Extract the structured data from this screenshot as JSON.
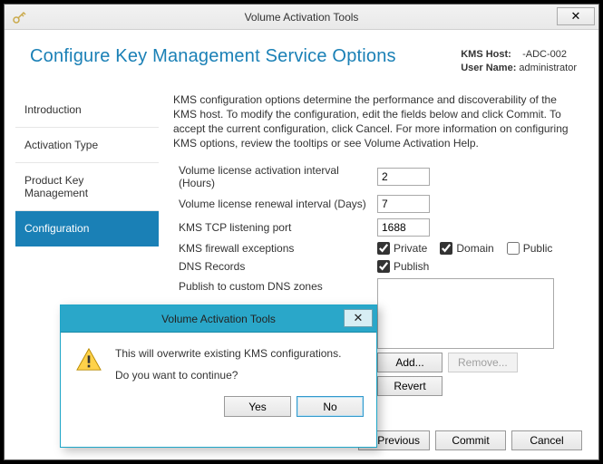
{
  "window": {
    "title": "Volume Activation Tools",
    "close_glyph": "✕"
  },
  "header": {
    "title": "Configure Key Management Service Options",
    "kms_host_label": "KMS Host:",
    "kms_host_value": "-ADC-002",
    "user_label": "User Name:",
    "user_value": "administrator"
  },
  "sidebar": {
    "items": [
      {
        "label": "Introduction"
      },
      {
        "label": "Activation Type"
      },
      {
        "label": "Product Key Management"
      },
      {
        "label": "Configuration"
      }
    ],
    "active_index": 3
  },
  "content": {
    "description": "KMS configuration options determine the performance and discoverability of the KMS host. To modify the configuration, edit the fields below and click Commit. To accept the current configuration, click Cancel. For more information on configuring KMS options, review the tooltips or see Volume Activation Help.",
    "fields": {
      "activation_interval_label": "Volume license activation interval (Hours)",
      "activation_interval_value": "2",
      "renewal_interval_label": "Volume license renewal interval (Days)",
      "renewal_interval_value": "7",
      "tcp_port_label": "KMS TCP listening port",
      "tcp_port_value": "1688",
      "firewall_label": "KMS firewall exceptions",
      "firewall_private": "Private",
      "firewall_domain": "Domain",
      "firewall_public": "Public",
      "dns_label": "DNS Records",
      "dns_publish": "Publish",
      "custom_dns_label": "Publish to custom DNS zones",
      "add_btn": "Add...",
      "remove_btn": "Remove...",
      "revert_btn": "Revert"
    }
  },
  "footer": {
    "previous": "<  Previous",
    "commit": "Commit",
    "cancel": "Cancel"
  },
  "dialog": {
    "title": "Volume Activation Tools",
    "close_glyph": "✕",
    "line1": "This will overwrite existing KMS configurations.",
    "line2": "Do you want to continue?",
    "yes": "Yes",
    "no": "No"
  }
}
